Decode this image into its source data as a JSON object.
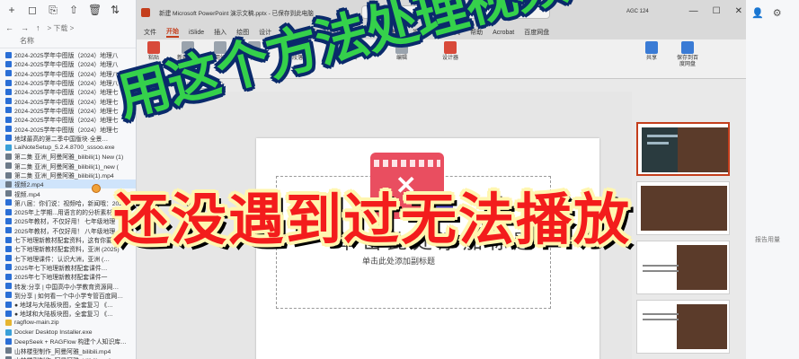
{
  "explorer": {
    "toolbar_icons": [
      "plus-icon",
      "back-icon",
      "copy-icon",
      "share-icon",
      "delete-icon",
      "sort-icon"
    ],
    "toolbar_glyphs": [
      "+",
      "◻",
      "⎘",
      "⇧",
      "🗑",
      "⇅"
    ],
    "nav_back": "←",
    "nav_forward": "→",
    "nav_up": "↑",
    "path_text": "> 下载 >",
    "header": "名称",
    "files": [
      {
        "name": "2024-2025学年中图版（2024）地理八",
        "type": "doc"
      },
      {
        "name": "2024-2025学年中图版（2024）地理八",
        "type": "doc"
      },
      {
        "name": "2024-2025学年中图版（2024）地理八",
        "type": "doc"
      },
      {
        "name": "2024-2025学年中图版（2024）地理八",
        "type": "doc"
      },
      {
        "name": "2024-2025学年中图版（2024）地理七",
        "type": "doc"
      },
      {
        "name": "2024-2025学年中图版（2024）地理七",
        "type": "doc"
      },
      {
        "name": "2024-2025学年中图版（2024）地理七",
        "type": "doc"
      },
      {
        "name": "2024-2025学年中图版（2024）地理七",
        "type": "doc"
      },
      {
        "name": "2024-2025学年中图版（2024）地理七",
        "type": "doc"
      },
      {
        "name": "地球最高的第二季中国版块·全景…",
        "type": "doc"
      },
      {
        "name": "LaiNoteSetup_5.2.4.8700_sssoo.exe",
        "type": "exe"
      },
      {
        "name": "第二集 亚洲_阿曼阿雅_bilibili(1) New (1)",
        "type": "vid"
      },
      {
        "name": "第二集 亚洲_阿曼阿雅_bilibili(1)_new (",
        "type": "vid"
      },
      {
        "name": "第二集 亚洲_阿曼阿雅_bilibili(1).mp4",
        "type": "vid"
      },
      {
        "name": "视频2.mp4",
        "type": "vid",
        "selected": true
      },
      {
        "name": "视频.mp4",
        "type": "vid"
      },
      {
        "name": "第八届：你们说：视频哈，新闻哦：2025年",
        "type": "doc"
      },
      {
        "name": "2025年上学期...用语言的的分析素材",
        "type": "doc"
      },
      {
        "name": "2025年教材，不仅好用！ 七年级地理",
        "type": "doc"
      },
      {
        "name": "2025年教材，不仅好用！ 八年级地理",
        "type": "doc"
      },
      {
        "name": "七下地理新教材配套资料，这有你要的吗？",
        "type": "doc"
      },
      {
        "name": "七下地理新教材配套资料，亚洲 (2025)",
        "type": "doc"
      },
      {
        "name": "七下地理课件：认识大洲，亚洲 (…",
        "type": "doc"
      },
      {
        "name": "2025年七下地理新教材配套课件…",
        "type": "doc"
      },
      {
        "name": "2025年七下地理新教材配套课件一",
        "type": "doc"
      },
      {
        "name": "转发:分享 | 中国高中小学教育资源网…",
        "type": "doc"
      },
      {
        "name": "到分享 | 如何看一个中小学专管百度网…",
        "type": "doc"
      },
      {
        "name": "● 地球与大陆板块图，全套复习 《…",
        "type": "doc"
      },
      {
        "name": "● 地球和大陆板块图，全套复习 《…",
        "type": "doc"
      },
      {
        "name": "ragflow-main.zip",
        "type": "zip"
      },
      {
        "name": "Docker Desktop Installer.exe",
        "type": "exe"
      },
      {
        "name": "DeepSeek + RAGFlow 构建个人知识库…",
        "type": "doc"
      },
      {
        "name": "山林楼型制作_阿曼阿雅_bilibili.mp4",
        "type": "vid"
      },
      {
        "name": "山林楼型制作_阿曼阿雅_bilibili.mp4",
        "type": "vid"
      },
      {
        "name": "PAInstall.zip",
        "type": "zip"
      }
    ]
  },
  "ppt": {
    "window_title": "新建 Microsoft PowerPoint 演示文稿.pptx - 已保存到此电脑",
    "search_icon": "⌕",
    "search_placeholder": "搜索",
    "user": "AGC 124",
    "win_controls": [
      "—",
      "☐",
      "✕"
    ],
    "tabs": [
      {
        "label": "文件"
      },
      {
        "label": "开始",
        "active": true
      },
      {
        "label": "iSlide"
      },
      {
        "label": "插入"
      },
      {
        "label": "绘图"
      },
      {
        "label": "设计"
      },
      {
        "label": "切换"
      },
      {
        "label": "动画"
      },
      {
        "label": "幻灯片放映"
      },
      {
        "label": "录制"
      },
      {
        "label": "审阅"
      },
      {
        "label": "视图"
      },
      {
        "label": "开发工具"
      },
      {
        "label": "帮助"
      },
      {
        "label": "Acrobat"
      },
      {
        "label": "百度网盘"
      }
    ],
    "ribbon_buttons": [
      {
        "label": "粘贴",
        "color": "red"
      },
      {
        "label": "新建幻灯片",
        "color": "gray"
      },
      {
        "label": "重用幻灯片",
        "color": "gray"
      },
      {
        "label": "字体",
        "color": "gray"
      },
      {
        "label": "段落",
        "color": "gray"
      },
      {
        "label": "绘图",
        "color": "blue"
      },
      {
        "label": "编辑",
        "color": "gray"
      },
      {
        "label": "设计器",
        "color": "red"
      },
      {
        "label": "共享",
        "color": "blue"
      },
      {
        "label": "保存到百度网盘",
        "color": "blue"
      }
    ],
    "qat_icons": [
      "undo-icon",
      "redo-icon",
      "save-icon",
      "present-icon"
    ],
    "qat_glyphs": [
      "↶",
      "↷",
      "🖫",
      "▣"
    ],
    "slide": {
      "title": "单击此处添加标题",
      "subtitle": "单击此处添加副标题"
    }
  },
  "overlay": {
    "headline_top": "用这个方法处理视频",
    "headline_bottom": "还没遇到过无法播放"
  },
  "right_strip": {
    "icons": [
      "person-icon",
      "settings-icon"
    ],
    "icon_glyphs": [
      "👤",
      "⚙"
    ],
    "label": "报告用量"
  },
  "colors": {
    "headline_top": "#35d14b",
    "headline_bottom": "#f31c1c",
    "ppt_accent": "#c43e1c",
    "video_icon": "#e94e60"
  }
}
